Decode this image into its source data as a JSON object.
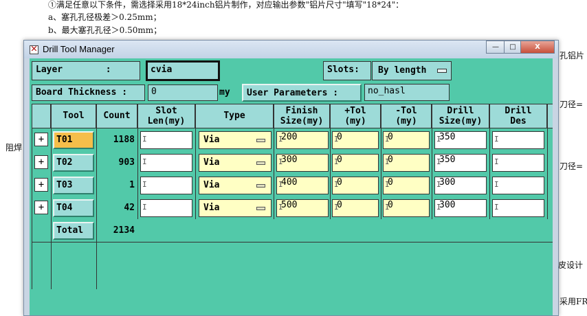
{
  "background_doc": {
    "line1": "①满足任意以下条件，需选择采用18*24inch铝片制作，对应输出参数\"铝片尺寸\"填写\"18*24\"：",
    "line2": "a、塞孔孔径极差＞0.25mm；",
    "line3": "b、最大塞孔孔径＞0.50mm；",
    "right1": "孔铝片",
    "right2": "刀径=",
    "right3": "刀径=",
    "right4": "皮设计",
    "right5": "采用FR",
    "left1": "阻焊"
  },
  "window": {
    "title": "Drill Tool Manager",
    "minimize": "—",
    "maximize": "□",
    "close": "X"
  },
  "form": {
    "layer_label": "Layer        :",
    "layer_value": "cvia",
    "slots_label": "Slots:",
    "slots_value": "By length",
    "board_thickness_label": "Board Thickness :",
    "board_thickness_value": "0",
    "unit": "my",
    "user_params_label": "User Parameters :",
    "user_params_value": "no_hasl"
  },
  "table": {
    "headers": {
      "tool": "Tool",
      "count": "Count",
      "slot_len": "Slot\nLen(my)",
      "type": "Type",
      "finish": "Finish\nSize(my)",
      "plus_tol": "+Tol\n(my)",
      "minus_tol": "-Tol\n(my)",
      "drill_size": "Drill\nSize(my)",
      "drill_des": "Drill\nDes"
    },
    "rows": [
      {
        "expand": "+",
        "tool": "T01",
        "count": "1188",
        "slot_len": "",
        "type": "Via",
        "finish": "200",
        "plus_tol": "0",
        "minus_tol": "0",
        "drill_size": "350",
        "drill_des": ""
      },
      {
        "expand": "+",
        "tool": "T02",
        "count": "903",
        "slot_len": "",
        "type": "Via",
        "finish": "300",
        "plus_tol": "0",
        "minus_tol": "0",
        "drill_size": "350",
        "drill_des": ""
      },
      {
        "expand": "+",
        "tool": "T03",
        "count": "1",
        "slot_len": "",
        "type": "Via",
        "finish": "400",
        "plus_tol": "0",
        "minus_tol": "0",
        "drill_size": "300",
        "drill_des": ""
      },
      {
        "expand": "+",
        "tool": "T04",
        "count": "42",
        "slot_len": "",
        "type": "Via",
        "finish": "500",
        "plus_tol": "0",
        "minus_tol": "0",
        "drill_size": "300",
        "drill_des": ""
      }
    ],
    "total_label": "Total",
    "total_count": "2134"
  },
  "colors": {
    "client_bg": "#52c9a9",
    "label_bg": "#9ddbd8",
    "selected_tool": "#f5be4a",
    "yellow_field": "#ffffc4"
  }
}
